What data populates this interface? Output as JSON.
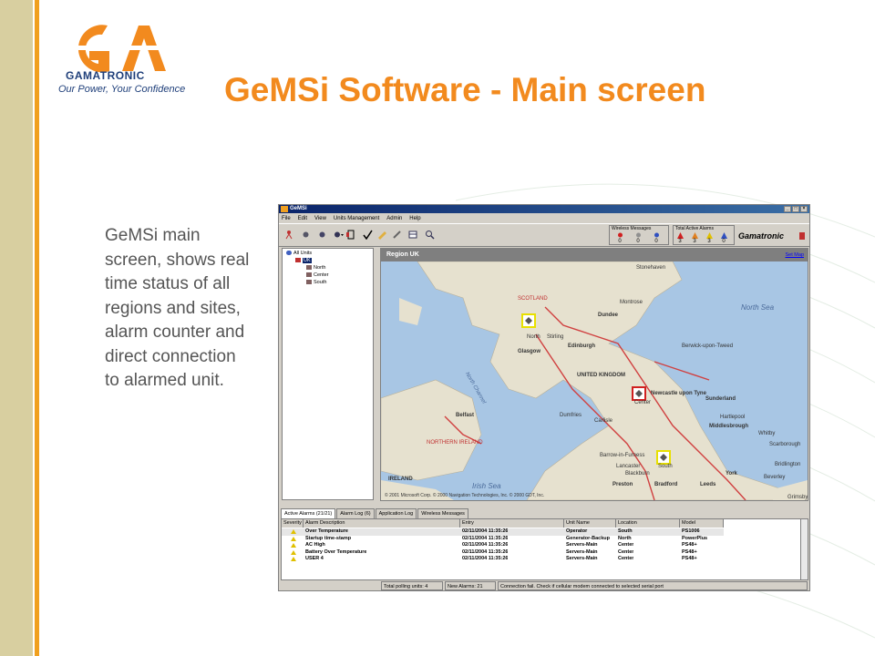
{
  "logo": {
    "name": "GAMATRONIC",
    "tagline": "Our Power, Your Confidence"
  },
  "slide_title": "GeMSi Software - Main screen",
  "description": "GeMSi main screen, shows real time status of all regions and sites, alarm counter and direct connection to alarmed unit.",
  "app": {
    "window_title": "GeMSi",
    "window_buttons": [
      "_",
      "□",
      "×"
    ],
    "menu": [
      "File",
      "Edit",
      "View",
      "Units Management",
      "Admin",
      "Help"
    ],
    "wireless_panel": {
      "title": "Wireless Messages",
      "counts": [
        "0",
        "0",
        "0"
      ]
    },
    "alarms_panel": {
      "title": "Total Active Alarms",
      "counts": [
        "3",
        "3",
        "3",
        "0"
      ]
    },
    "brand": "Gamatronic",
    "tree": {
      "root": "All Units",
      "country": "UK",
      "regions": [
        "North",
        "Center",
        "South"
      ]
    },
    "map": {
      "region_title": "Region UK",
      "set_map": "Set Map",
      "copyright": "© 2001 Microsoft Corp. © 2000 Navigation Technologies, Inc. © 2000 GDT, Inc.",
      "site_labels": [
        "North",
        "Center",
        "South"
      ],
      "labels": {
        "scotland": "SCOTLAND",
        "uk": "UNITED KINGDOM",
        "northern_ireland": "NORTHERN IRELAND",
        "ireland": "IRELAND",
        "north_sea": "North Sea",
        "irish_sea": "Irish Sea",
        "north_channel": "North Channel",
        "dundee": "Dundee",
        "glasgow": "Glasgow",
        "edinburgh": "Edinburgh",
        "newcastle": "Newcastle upon Tyne",
        "sunderland": "Sunderland",
        "middlesbrough": "Middlesbrough",
        "belfast": "Belfast",
        "preston": "Preston",
        "bradford": "Bradford",
        "leeds": "Leeds",
        "york": "York",
        "scarborough": "Scarborough",
        "stirling": "Stirling",
        "carlisle": "Carlisle",
        "hartlepool": "Hartlepool",
        "grimsby": "Grimsby",
        "dumfries": "Dumfries",
        "montrose": "Montrose",
        "aberdeen": "Stonehaven",
        "berwick": "Berwick-upon-Tweed",
        "blackburn": "Blackburn",
        "barrow": "Barrow-in-Furness",
        "lancaster": "Lancaster",
        "whitby": "Whitby",
        "bridlington": "Bridlington",
        "beverley": "Beverley"
      }
    },
    "tabs": [
      "Active Alarms (21/21)",
      "Alarm Log (6)",
      "Application Log",
      "Wireless Messages"
    ],
    "grid": {
      "headers": [
        "Severity",
        "Alarm Description",
        "Entry",
        "Unit Name",
        "Location",
        "Model"
      ],
      "rows": [
        {
          "description": "Over Temperature",
          "entry": "02/11/2004 11:35:26",
          "unit": "Operator",
          "location": "South",
          "model": "PS1006"
        },
        {
          "description": "Startup time-stamp",
          "entry": "02/11/2004 11:35:26",
          "unit": "Generator-Backup",
          "location": "North",
          "model": "PowerPlus"
        },
        {
          "description": "AC High",
          "entry": "02/11/2004 11:35:26",
          "unit": "Servers-Main",
          "location": "Center",
          "model": "PS48+"
        },
        {
          "description": "Battery Over Temperature",
          "entry": "02/11/2004 11:35:26",
          "unit": "Servers-Main",
          "location": "Center",
          "model": "PS48+"
        },
        {
          "description": "USER 4",
          "entry": "02/11/2004 11:35:26",
          "unit": "Servers-Main",
          "location": "Center",
          "model": "PS48+"
        }
      ]
    },
    "status": {
      "polling": "Total polling units: 4",
      "new_alarms": "New Alarms: 21",
      "message": "Connection fail. Check if cellular modem connected to selected serial port"
    }
  },
  "colors": {
    "accent": "#f28a1e",
    "side_strip": "#d8cfa0",
    "brand_blue": "#1f3f7a"
  }
}
